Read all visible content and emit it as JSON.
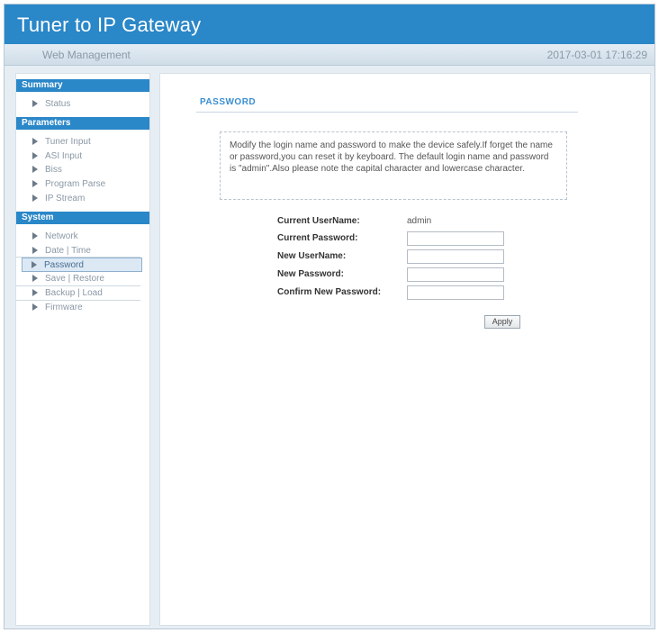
{
  "header": {
    "title": "Tuner to IP Gateway"
  },
  "subbar": {
    "management_label": "Web Management",
    "datetime": "2017-03-01 17:16:29"
  },
  "sidebar": {
    "sections": [
      {
        "title": "Summary",
        "items": [
          "Status"
        ]
      },
      {
        "title": "Parameters",
        "items": [
          "Tuner Input",
          "ASI Input",
          "Biss",
          "Program Parse",
          "IP Stream"
        ]
      },
      {
        "title": "System",
        "items": [
          "Network",
          "Date | Time",
          "Password",
          "Save | Restore",
          "Backup | Load",
          "Firmware"
        ]
      }
    ],
    "active_item": "Password"
  },
  "main": {
    "page_title": "PASSWORD",
    "notice": "Modify the login name and password to make the device safely.If forget the name or password,you can reset it by keyboard. The default login name and password is \"admin\".Also please note the capital character and lowercase character.",
    "form": {
      "current_username_label": "Current UserName:",
      "current_username_value": "admin",
      "current_password_label": "Current Password:",
      "new_username_label": "New UserName:",
      "new_password_label": "New Password:",
      "confirm_password_label": "Confirm New Password:",
      "current_password_value": "",
      "new_username_value": "",
      "new_password_value": "",
      "confirm_password_value": ""
    },
    "apply_label": "Apply"
  }
}
